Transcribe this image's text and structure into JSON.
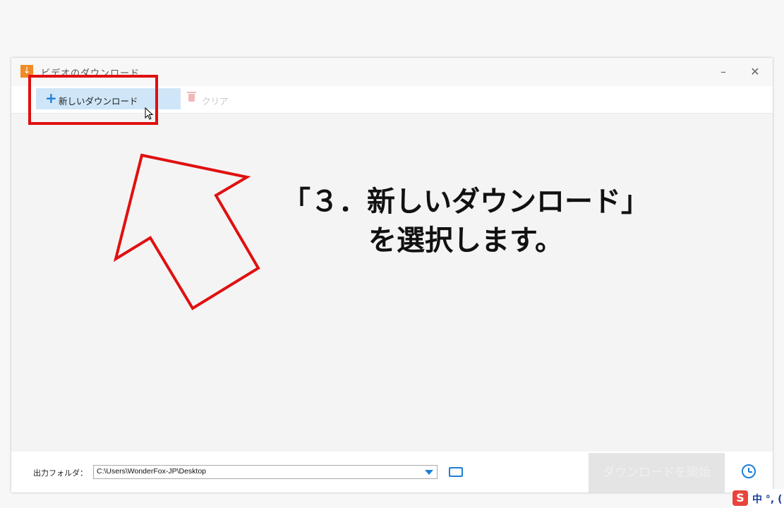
{
  "window": {
    "title": "ビデオのダウンロード",
    "minimize": "–",
    "close": "✕"
  },
  "toolbar": {
    "new_download": "新しいダウンロード",
    "clear": "クリア"
  },
  "caption": {
    "line1": "「３．新しいダウンロード」",
    "line2": "を選択します。"
  },
  "bottom": {
    "output_label": "出力フォルダ：",
    "output_path": "C:\\Users\\WonderFox-JP\\Desktop",
    "start_button": "ダウンロードを開始"
  },
  "ime": {
    "logo": "S",
    "text": "中 °, ("
  },
  "colors": {
    "accent": "#1c7fd6",
    "highlight": "#e01010",
    "button_bg": "#cfe6f8"
  }
}
